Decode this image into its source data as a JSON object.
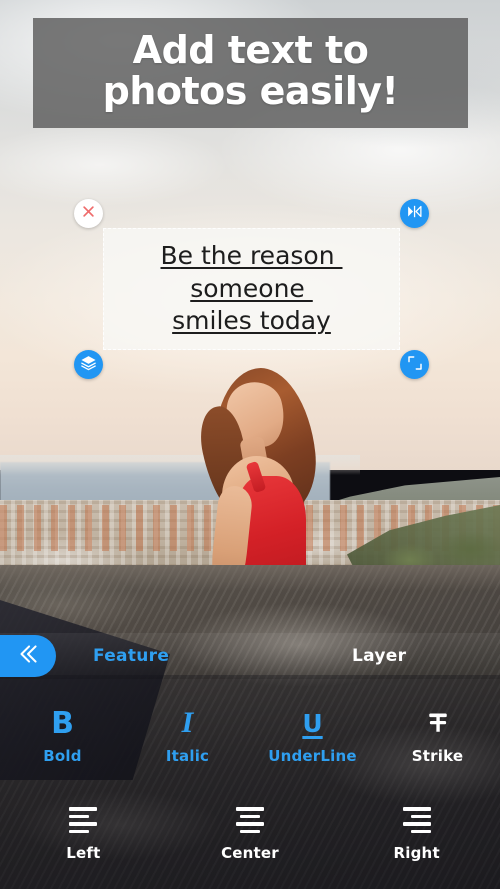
{
  "promo_banner": {
    "line1": "Add text to",
    "line2": "photos easily!",
    "bg_color": "#5c5c5c",
    "text_color": "#ffffff"
  },
  "text_overlay": {
    "lines": [
      "Be the reason ",
      "someone ",
      "smiles today"
    ],
    "full_text": "Be the reason someone smiles today",
    "box_fill": "#f7f7f5",
    "text_color": "#1d1d1d",
    "style": "underline",
    "handles": [
      {
        "name": "close-handle",
        "icon": "close-icon",
        "color": "#ffffff",
        "icon_color": "#ef6b6b"
      },
      {
        "name": "flip-handle",
        "icon": "flip-horizontal-icon",
        "color": "#2196f3",
        "icon_color": "#ffffff"
      },
      {
        "name": "layer-handle",
        "icon": "layers-icon",
        "color": "#2196f3",
        "icon_color": "#ffffff"
      },
      {
        "name": "resize-handle",
        "icon": "resize-icon",
        "color": "#2196f3",
        "icon_color": "#ffffff"
      }
    ]
  },
  "toolbar": {
    "back_icon": "double-chevron-left-icon",
    "back_bg": "#2196f3",
    "tabs": [
      {
        "label": "Feature",
        "active": true,
        "color": "#2f9ff0"
      },
      {
        "label": "Layer",
        "active": false,
        "color": "#ffffff"
      }
    ],
    "format_buttons": [
      {
        "label": "Bold",
        "glyph": "B",
        "icon": "bold-icon",
        "active": true
      },
      {
        "label": "Italic",
        "glyph": "I",
        "icon": "italic-icon",
        "active": true
      },
      {
        "label": "UnderLine",
        "glyph": "U",
        "icon": "underline-icon",
        "active": true
      },
      {
        "label": "Strike",
        "glyph": "T",
        "icon": "strikethrough-icon",
        "active": false
      }
    ],
    "align_buttons": [
      {
        "label": "Left",
        "icon": "align-left-icon",
        "active": false
      },
      {
        "label": "Center",
        "icon": "align-center-icon",
        "active": false
      },
      {
        "label": "Right",
        "icon": "align-right-icon",
        "active": false
      }
    ]
  },
  "accent_color": "#2196f3"
}
